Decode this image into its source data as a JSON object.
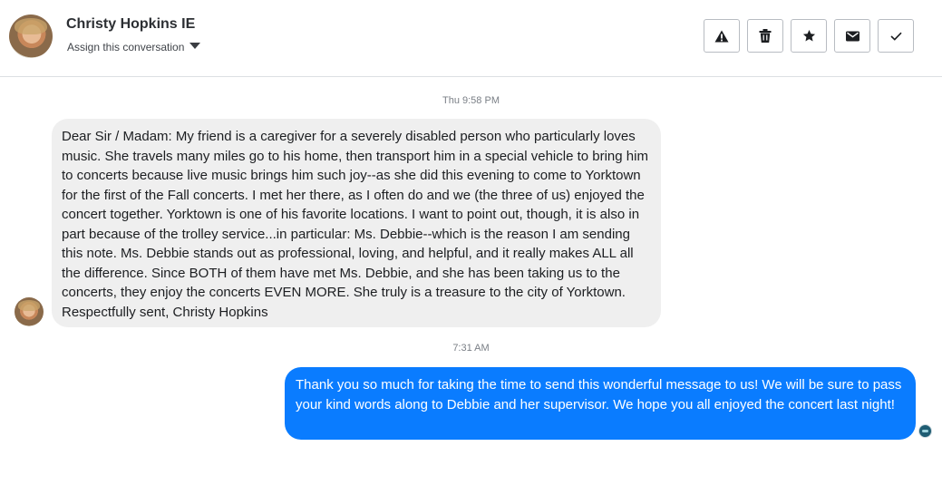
{
  "header": {
    "contact_name": "Christy Hopkins IE",
    "assign_label": "Assign this conversation",
    "actions": [
      {
        "name": "report-spam-button",
        "icon": "warning-icon"
      },
      {
        "name": "delete-button",
        "icon": "trash-icon"
      },
      {
        "name": "star-button",
        "icon": "star-icon"
      },
      {
        "name": "mark-unread-button",
        "icon": "envelope-icon"
      },
      {
        "name": "mark-done-button",
        "icon": "checkmark-icon"
      }
    ]
  },
  "messages": {
    "timestamp_1": "Thu 9:58 PM",
    "incoming_text": "Dear Sir / Madam: My friend is a caregiver for a severely disabled person who particularly loves music. She travels many miles go to his home, then transport him in a special vehicle to bring him to concerts because live music brings him such joy--as she did this evening to come to Yorktown for the first of  the Fall concerts. I met her there, as I often do and we (the three of us) enjoyed the concert together. Yorktown is one of his favorite locations. I want to point out, though, it is also in part because of the trolley service...in particular: Ms. Debbie--which is the reason I am sending this note. Ms. Debbie stands out as professional, loving, and helpful, and it really makes ALL all the difference. Since BOTH of them have met Ms. Debbie, and she has been taking us to the concerts, they enjoy the concerts EVEN MORE. She truly is a treasure to the city of Yorktown. Respectfully sent, Christy Hopkins",
    "timestamp_2": "7:31 AM",
    "outgoing_text": "Thank you so much for taking the time to send this wonderful message to us! We will be sure to pass your kind words along to Debbie and her supervisor. We hope you all enjoyed the concert last night!"
  },
  "colors": {
    "outgoing_bubble": "#0a7cff",
    "incoming_bubble": "#efefef"
  }
}
